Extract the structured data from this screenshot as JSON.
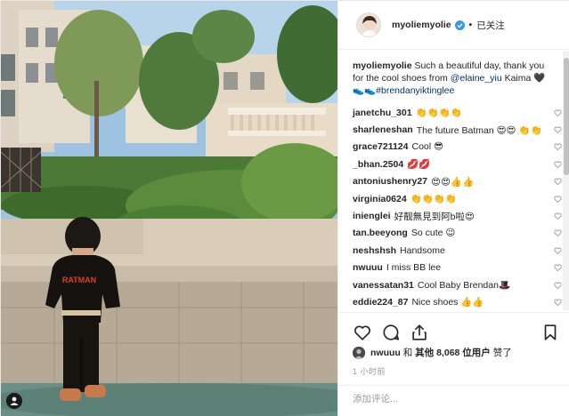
{
  "post": {
    "username": "myoliemyolie",
    "follow_status": "已关注",
    "dot": "•",
    "photo_label": "RATMAN",
    "caption": {
      "username": "myoliemyolie",
      "text_before": "Such a beautiful day, thank you for the cool shoes from ",
      "mention": "@elaine_yiu",
      "text_mid": " Kaima ",
      "emoji": "🖤👟👟",
      "hashtag": "#brendanyiktinglee"
    }
  },
  "comments": [
    {
      "name": "janetchu_301",
      "text": "👏👏👏👏"
    },
    {
      "name": "sharleneshan",
      "text": "The future Batman 😍😍 👏👏"
    },
    {
      "name": "grace721124",
      "text": "Cool 😎"
    },
    {
      "name": "_bhan.2504",
      "text": "💋💋"
    },
    {
      "name": "antoniushenry27",
      "text": "😍😍👍👍"
    },
    {
      "name": "virginia0624",
      "text": "👏👏👏👏"
    },
    {
      "name": "inienglei",
      "text": "好靓無見到阿b啦😍"
    },
    {
      "name": "tan.beeyong",
      "text": "So cute 😉"
    },
    {
      "name": "neshshsh",
      "text": "Handsome"
    },
    {
      "name": "nwuuu",
      "text": "I miss BB lee"
    },
    {
      "name": "vanessatan31",
      "text": "Cool Baby Brendan🎩"
    },
    {
      "name": "eddie224_87",
      "text": "Nice shoes 👍👍"
    }
  ],
  "likes": {
    "user": "nwuuu",
    "and": "和",
    "others_label": "其他",
    "count": "8,068",
    "suffix": "位用户",
    "verb": "赞了"
  },
  "time_ago": "1 小时前",
  "add_comment": {
    "placeholder": "添加评论..."
  },
  "icons": {
    "verified": "verified-badge-icon",
    "like": "heart-outline-icon",
    "comment": "speech-bubble-icon",
    "share": "share-arrow-icon",
    "save": "bookmark-icon",
    "comment_like": "small-heart-icon",
    "account": "account-badge-icon"
  },
  "colors": {
    "verified": "#3897f0",
    "link": "#003569",
    "border": "#efefef",
    "muted": "#999999"
  }
}
